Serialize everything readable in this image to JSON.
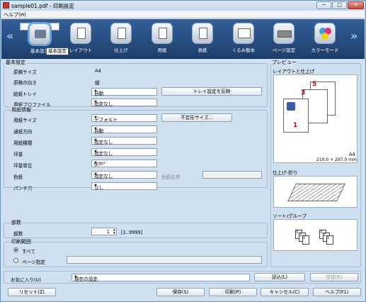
{
  "window": {
    "title": "sample01.pdf - 印刷設定",
    "minimize": "─",
    "maximize": "□",
    "close": "✕"
  },
  "menu": {
    "help": "ヘルプ(H)"
  },
  "toolbar": {
    "left_arrow": "«",
    "right_arrow": "»",
    "tooltip": "基本設定",
    "items": [
      {
        "label": "基本設定",
        "icon": "basic-settings-icon"
      },
      {
        "label": "レイアウト",
        "icon": "layout-icon"
      },
      {
        "label": "仕上げ",
        "icon": "finishing-icon"
      },
      {
        "label": "用紙",
        "icon": "paper-icon"
      },
      {
        "label": "表紙",
        "icon": "cover-icon"
      },
      {
        "label": "くるみ製本",
        "icon": "binding-icon"
      },
      {
        "label": "ページ設定",
        "icon": "page-settings-icon"
      },
      {
        "label": "カラーモード",
        "icon": "color-mode-icon"
      }
    ]
  },
  "basic": {
    "legend": "基本設定",
    "original_size_label": "原稿サイズ",
    "original_size": "A4",
    "orientation_label": "原稿の向き",
    "orientation": "縦",
    "tray_label": "給紙トレイ",
    "tray": "自動",
    "tray_button": "トレイ設定を反映",
    "profile_label": "用紙プロファイル",
    "profile": "指定なし"
  },
  "paper": {
    "legend": "用紙情報",
    "size_label": "用紙サイズ",
    "size": "デフォルト",
    "custom_button": "不定形サイズ...",
    "direction_label": "通紙方向",
    "direction": "自動",
    "type_label": "用紙種類",
    "type": "指定なし",
    "weight_label": "坪量",
    "weight": "指定なし",
    "unit_label": "坪量単位",
    "unit": "g/m²",
    "color_label": "色紙",
    "color": "指定なし",
    "color_name_label": "色紙名称",
    "punch_label": "パンチ穴",
    "punch": "なし"
  },
  "copies": {
    "legend": "部数",
    "label": "部数",
    "value": "1",
    "range": "[1..9999]"
  },
  "range": {
    "legend": "印刷範囲",
    "all": "すべて",
    "pages": "ページ指定"
  },
  "preview": {
    "legend": "プレビュー",
    "layout_label": "レイアウトと仕上げ",
    "page_numbers": [
      "5",
      "3",
      "1"
    ],
    "paper_info": "A4",
    "paper_dims": "210.0 × 297.0 mm",
    "fold_label": "仕上げ-折り",
    "sort_label": "ソート/グループ",
    "sort_pages": [
      "3",
      "2",
      "1",
      "3",
      "2",
      "1"
    ]
  },
  "bottom": {
    "favorites_label": "お気に入り(U)",
    "favorites": "現在の設定",
    "load": "読込(L)",
    "register": "登録(R)",
    "reset": "リセット(Z)",
    "save": "保存(S)",
    "print": "印刷(P)",
    "cancel": "キャンセル(C)",
    "help": "ヘルプ(F1)"
  }
}
